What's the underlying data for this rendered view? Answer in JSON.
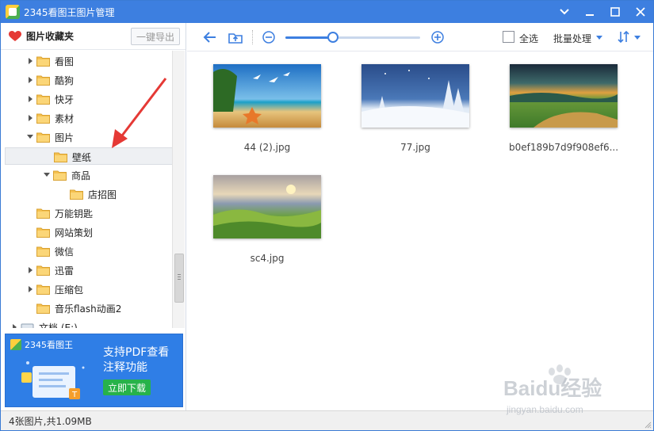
{
  "window": {
    "title": "2345看图王图片管理"
  },
  "sidebar": {
    "favorites_label": "图片收藏夹",
    "export_button": "一键导出",
    "tree": [
      {
        "label": "看图",
        "expandable": true,
        "expanded": false,
        "level": 1
      },
      {
        "label": "酷狗",
        "expandable": true,
        "expanded": false,
        "level": 1
      },
      {
        "label": "快牙",
        "expandable": true,
        "expanded": false,
        "level": 1
      },
      {
        "label": "素材",
        "expandable": true,
        "expanded": false,
        "level": 1
      },
      {
        "label": "图片",
        "expandable": true,
        "expanded": true,
        "level": 1
      },
      {
        "label": "壁纸",
        "expandable": false,
        "expanded": false,
        "level": 2,
        "selected": true
      },
      {
        "label": "商品",
        "expandable": true,
        "expanded": true,
        "level": 2
      },
      {
        "label": "店招图",
        "expandable": false,
        "expanded": false,
        "level": 3
      },
      {
        "label": "万能钥匙",
        "expandable": false,
        "expanded": false,
        "level": 1
      },
      {
        "label": "网站策划",
        "expandable": false,
        "expanded": false,
        "level": 1
      },
      {
        "label": "微信",
        "expandable": false,
        "expanded": false,
        "level": 1
      },
      {
        "label": "迅雷",
        "expandable": true,
        "expanded": false,
        "level": 1
      },
      {
        "label": "压缩包",
        "expandable": true,
        "expanded": false,
        "level": 1
      },
      {
        "label": "音乐flash动画2",
        "expandable": false,
        "expanded": false,
        "level": 1
      },
      {
        "label": "文档 (E:)",
        "expandable": true,
        "expanded": false,
        "level": 0,
        "drive": true
      }
    ]
  },
  "ad": {
    "brand": "2345看图王",
    "line1": "支持PDF查看",
    "line2": "注释功能",
    "button": "立即下载"
  },
  "toolbar": {
    "select_all": "全选",
    "batch": "批量处理",
    "zoom_level": 0.35
  },
  "images": [
    {
      "name": "44 (2).jpg",
      "scene": "beach"
    },
    {
      "name": "77.jpg",
      "scene": "snow"
    },
    {
      "name": "b0ef189b7d9f908ef6...",
      "scene": "valley"
    },
    {
      "name": "sc4.jpg",
      "scene": "hills"
    }
  ],
  "status": {
    "text": "4张图片,共1.09MB"
  },
  "watermark": {
    "brand": "Baidu经验",
    "url": "jingyan.baidu.com"
  },
  "colors": {
    "accent": "#3d7fe0",
    "heart": "#e53935",
    "folder": "#f5c150",
    "ad_bg": "#2f7ee6",
    "ad_button": "#27b24a",
    "annotation": "#e53935"
  }
}
